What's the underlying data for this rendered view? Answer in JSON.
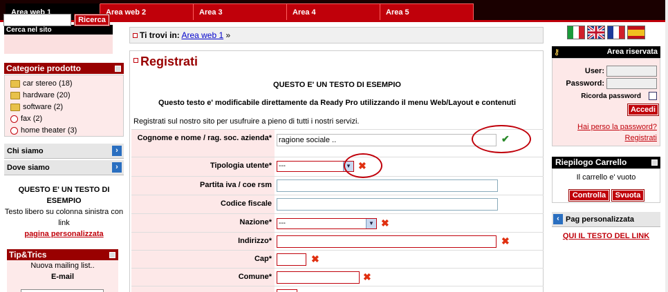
{
  "nav": {
    "tabs": [
      {
        "label": "Area web 1"
      },
      {
        "label": "Area web 2"
      },
      {
        "label": "Area 3"
      },
      {
        "label": "Area 4"
      },
      {
        "label": "Area 5"
      }
    ]
  },
  "search": {
    "title": "Cerca nel sito",
    "button": "Ricerca",
    "value": ""
  },
  "categories": {
    "title": "Categorie prodotto",
    "items": [
      {
        "label": "car stereo (18)",
        "icon": "folder-icon"
      },
      {
        "label": "hardware (20)",
        "icon": "folder-icon"
      },
      {
        "label": "software (2)",
        "icon": "folder-icon"
      },
      {
        "label": "fax (2)",
        "icon": "circle-icon"
      },
      {
        "label": "home theater (3)",
        "icon": "circle-icon"
      }
    ]
  },
  "side_links": [
    {
      "label": "Chi siamo"
    },
    {
      "label": "Dove siamo"
    }
  ],
  "left_text": {
    "heading": "QUESTO E' UN TESTO DI ESEMPIO",
    "body": "Testo libero su colonna sinistra con link",
    "link": "pagina personalizzata"
  },
  "tips": {
    "title": "Tip&Trics",
    "line1": "Nuova mailing list..",
    "line2": "E-mail"
  },
  "breadcrumb": {
    "prefix": "Ti trovi in:",
    "link": "Area web 1",
    "sep": "»"
  },
  "main": {
    "title": "Registrati",
    "example": "QUESTO E' UN TESTO DI ESEMPIO",
    "editable": "Questo testo e' modificabile direttamente da Ready Pro utilizzando il menu Web/Layout e contenuti",
    "intro": "Registrati sul nostro sito per usufruire a pieno di tutti i nostri servizi.",
    "fields": {
      "ragione": {
        "label": "Cognome e nome / rag. soc. azienda*",
        "value": "ragione sociale .."
      },
      "tipologia": {
        "label": "Tipologia utente*",
        "value": "---"
      },
      "piva": {
        "label": "Partita iva / coe rsm",
        "value": ""
      },
      "cf": {
        "label": "Codice fiscale",
        "value": ""
      },
      "nazione": {
        "label": "Nazione*",
        "value": "---"
      },
      "indirizzo": {
        "label": "Indirizzo*",
        "value": ""
      },
      "cap": {
        "label": "Cap*",
        "value": ""
      },
      "comune": {
        "label": "Comune*",
        "value": ""
      }
    }
  },
  "area_riservata": {
    "title": "Area riservata",
    "user_label": "User:",
    "password_label": "Password:",
    "remember": "Ricorda password",
    "login_button": "Accedi",
    "lost_password": "Hai perso la password?",
    "register": "Registrati"
  },
  "cart": {
    "title": "Riepilogo Carrello",
    "empty": "Il carrello e' vuoto",
    "check_button": "Controlla",
    "empty_button": "Svuota"
  },
  "pag_link": {
    "label": "Pag personalizzata"
  },
  "qui_link": "QUI IL TESTO DEL LINK",
  "colors": {
    "accent": "#c0000a",
    "dark": "#000000",
    "panel_pink": "#fde8e8"
  }
}
